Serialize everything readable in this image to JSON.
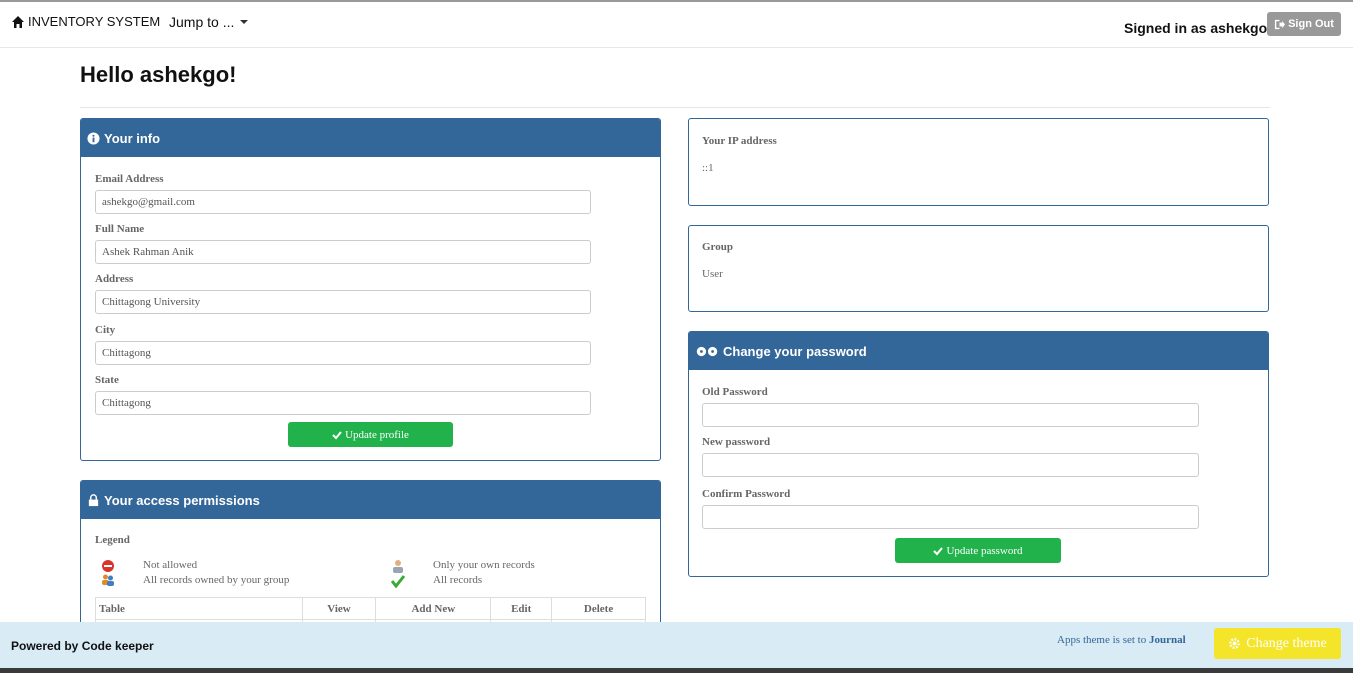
{
  "navbar": {
    "brand": "INVENTORY SYSTEM",
    "jump_label": "Jump to ...",
    "signed_in": "Signed in as ashekgo",
    "sign_out": "Sign Out"
  },
  "page": {
    "title": "Hello ashekgo!"
  },
  "your_info": {
    "title": "Your info",
    "fields": [
      {
        "label": "Email Address",
        "value": "ashekgo@gmail.com"
      },
      {
        "label": "Full Name",
        "value": "Ashek Rahman Anik"
      },
      {
        "label": "Address",
        "value": "Chittagong University"
      },
      {
        "label": "City",
        "value": "Chittagong"
      },
      {
        "label": "State",
        "value": "Chittagong"
      }
    ],
    "update_button": "Update profile"
  },
  "ip": {
    "label": "Your IP address",
    "value": "::1"
  },
  "group": {
    "label": "Group",
    "value": "User"
  },
  "password": {
    "title": "Change your password",
    "old_label": "Old Password",
    "new_label": "New password",
    "confirm_label": "Confirm Password",
    "old_value": "",
    "new_value": "",
    "confirm_value": "",
    "update_button": "Update password"
  },
  "permissions": {
    "title": "Your access permissions",
    "legend_label": "Legend",
    "legend": {
      "not_allowed": "Not allowed",
      "group_records": "All records owned by your group",
      "own_records": "Only your own records",
      "all_records": "All records"
    },
    "columns": [
      "Table",
      "View",
      "Add New",
      "Edit",
      "Delete"
    ]
  },
  "footer": {
    "powered": "Powered by Code keeper",
    "theme_prefix": "Apps theme is set to",
    "theme_name": "Journal",
    "change_theme": "Change theme"
  },
  "colors": {
    "primary": "#336699",
    "success": "#22b24c",
    "warning": "#f5e52a",
    "footer_bg": "#d9ebf5"
  }
}
